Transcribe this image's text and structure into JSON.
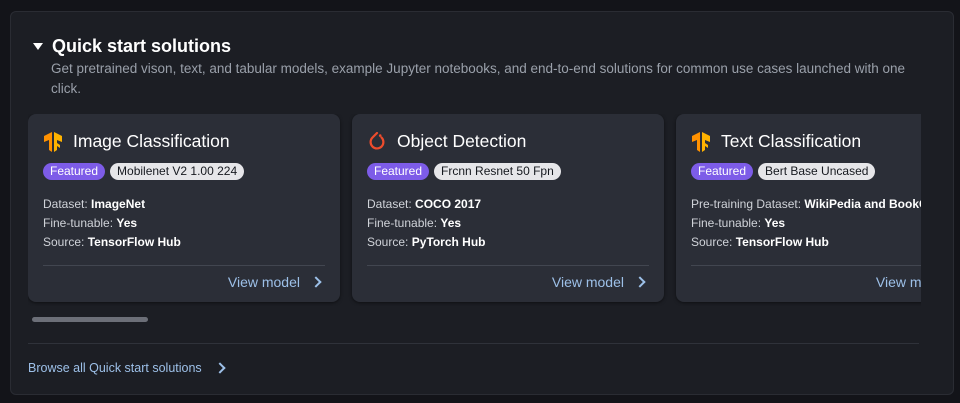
{
  "section": {
    "title": "Quick start solutions",
    "description": "Get pretrained vison, text, and tabular models, example Jupyter notebooks, and end-to-end solutions for common use cases launched with one click."
  },
  "cards": [
    {
      "title": "Image Classification",
      "icon": "tensorflow-icon",
      "featured_label": "Featured",
      "model_badge": "Mobilenet V2 1.00 224",
      "dataset_label": "Dataset:",
      "dataset": "ImageNet",
      "finetune_label": "Fine-tunable:",
      "finetune": "Yes",
      "source_label": "Source:",
      "source": "TensorFlow Hub",
      "link": "View model"
    },
    {
      "title": "Object Detection",
      "icon": "pytorch-icon",
      "featured_label": "Featured",
      "model_badge": "Frcnn Resnet 50 Fpn",
      "dataset_label": "Dataset:",
      "dataset": "COCO 2017",
      "finetune_label": "Fine-tunable:",
      "finetune": "Yes",
      "source_label": "Source:",
      "source": "PyTorch Hub",
      "link": "View model"
    },
    {
      "title": "Text Classification",
      "icon": "tensorflow-icon",
      "featured_label": "Featured",
      "model_badge": "Bert Base Uncased",
      "dataset_label": "Pre-training Dataset:",
      "dataset": "WikiPedia and BookCorpus",
      "finetune_label": "Fine-tunable:",
      "finetune": "Yes",
      "source_label": "Source:",
      "source": "TensorFlow Hub",
      "link": "View model"
    }
  ],
  "browse_link": "Browse all Quick start solutions",
  "colors": {
    "featured": "#7d5ce8",
    "link": "#9dc0e8",
    "tensorflow": "#ff9100",
    "pytorch": "#ee4c2c"
  }
}
